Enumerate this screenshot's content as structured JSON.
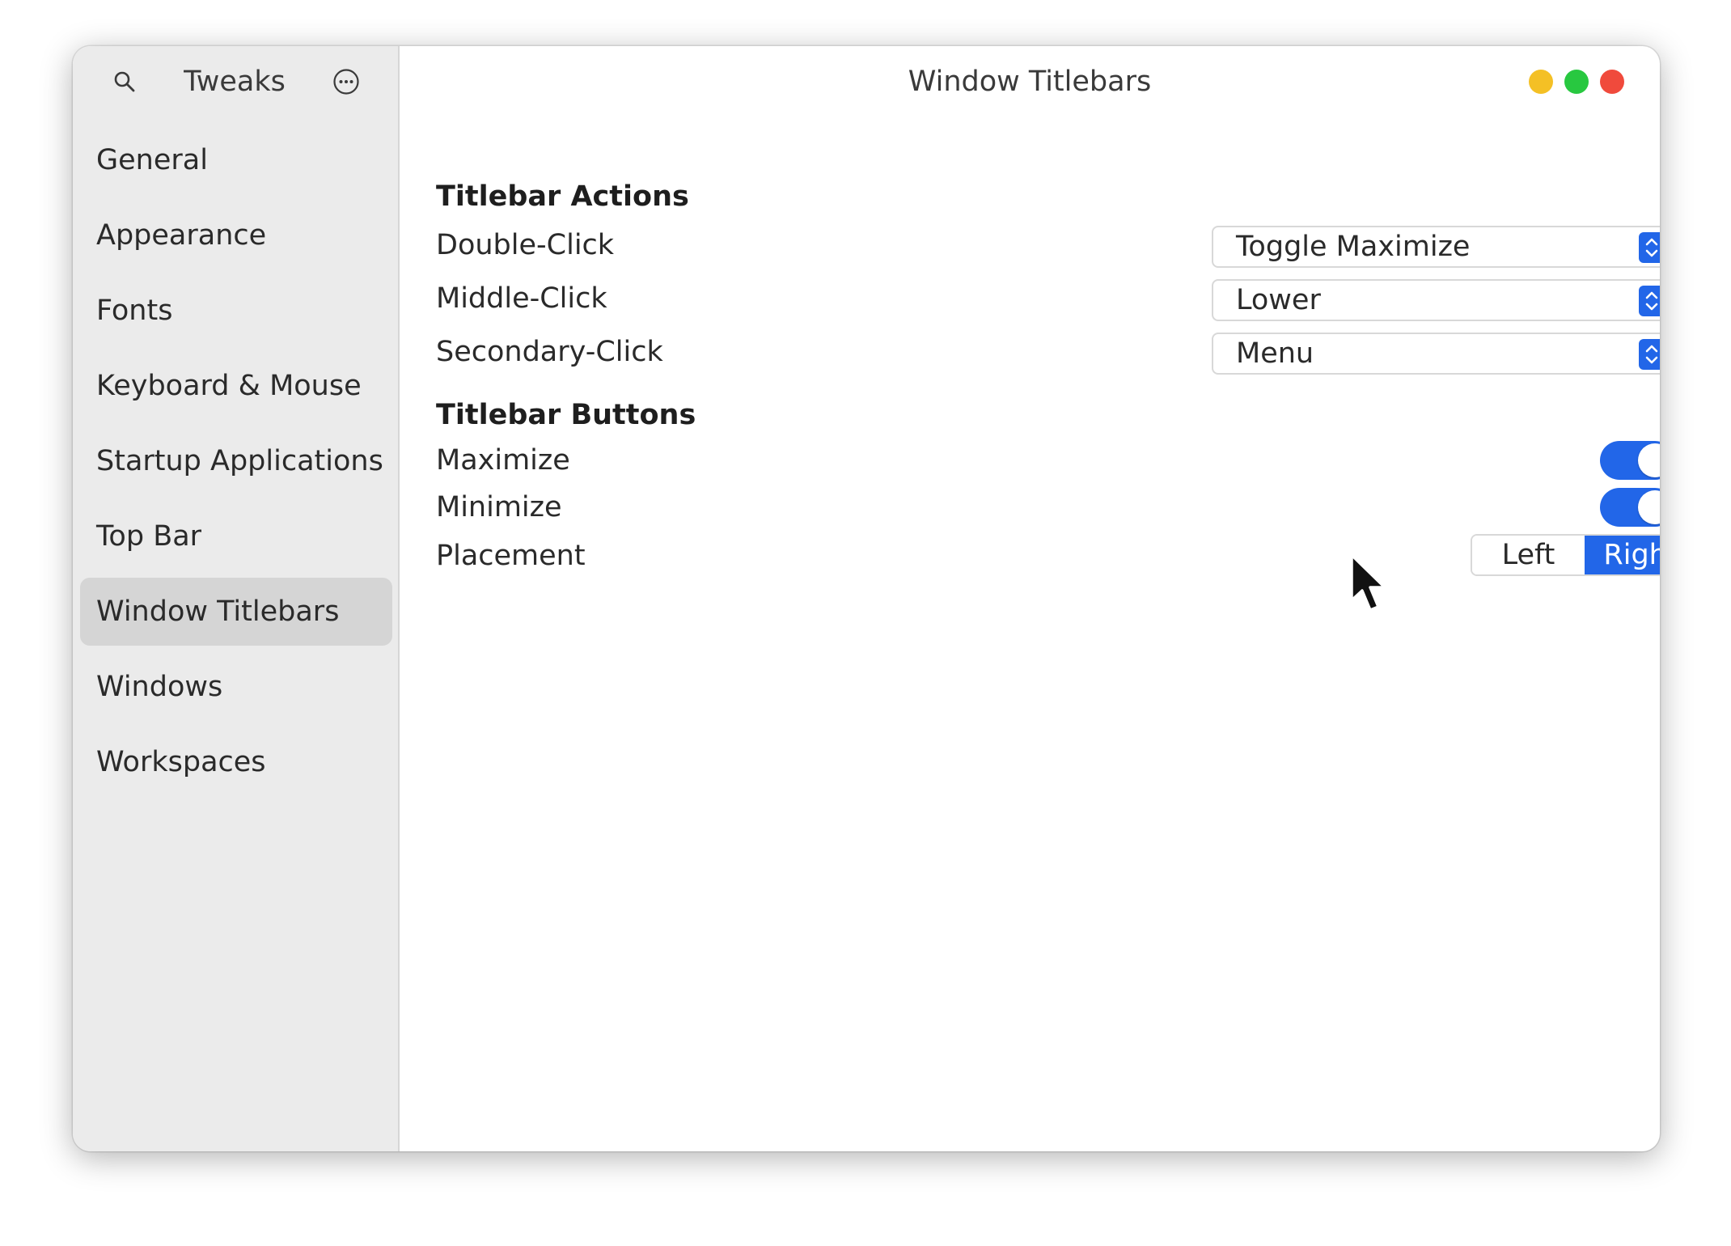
{
  "colors": {
    "accent": "#2266e8",
    "sidebar_bg": "#ebebeb",
    "sidebar_active_bg": "#d5d5d5",
    "minimize_dot": "#f4c025",
    "maximize_dot": "#28c840",
    "close_dot": "#f04a3c"
  },
  "sidebar": {
    "title": "Tweaks",
    "search_icon": "search-icon",
    "menu_icon": "ellipsis-menu-icon",
    "items": [
      {
        "label": "General",
        "active": false
      },
      {
        "label": "Appearance",
        "active": false
      },
      {
        "label": "Fonts",
        "active": false
      },
      {
        "label": "Keyboard & Mouse",
        "active": false
      },
      {
        "label": "Startup Applications",
        "active": false
      },
      {
        "label": "Top Bar",
        "active": false
      },
      {
        "label": "Window Titlebars",
        "active": true
      },
      {
        "label": "Windows",
        "active": false
      },
      {
        "label": "Workspaces",
        "active": false
      }
    ]
  },
  "main": {
    "title": "Window Titlebars",
    "sections": [
      {
        "header": "Titlebar Actions",
        "rows": [
          {
            "label": "Double-Click",
            "value": "Toggle Maximize"
          },
          {
            "label": "Middle-Click",
            "value": "Lower"
          },
          {
            "label": "Secondary-Click",
            "value": "Menu"
          }
        ]
      },
      {
        "header": "Titlebar Buttons",
        "rows": [
          {
            "label": "Maximize",
            "switch_on": true
          },
          {
            "label": "Minimize",
            "switch_on": true
          },
          {
            "label": "Placement",
            "options": [
              "Left",
              "Right"
            ],
            "selected": "Right"
          }
        ]
      }
    ]
  }
}
